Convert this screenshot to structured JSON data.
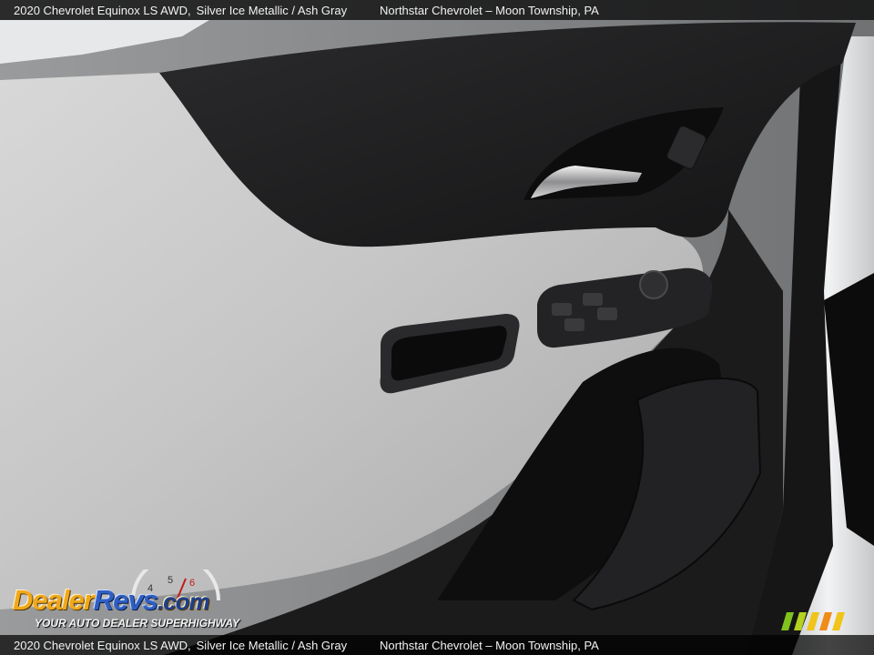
{
  "caption": {
    "vehicle": "2020 Chevrolet Equinox LS AWD,",
    "color": "Silver Ice Metallic / Ash Gray",
    "dealer": "Northstar Chevrolet – Moon Township, PA"
  },
  "logo": {
    "dealer": "Dealer",
    "revs": "Revs",
    "com": ".com",
    "tagline": "YOUR AUTO DEALER SUPERHIGHWAY",
    "gauge_numbers": [
      "4",
      "5",
      "6"
    ]
  },
  "colors": {
    "panel_gray": "#c9c9c9",
    "trim_black": "#1c1c1d",
    "logo_orange": "#f0a81c",
    "logo_blue": "#2f5fc4",
    "stripe_green": "#7fc31c"
  }
}
